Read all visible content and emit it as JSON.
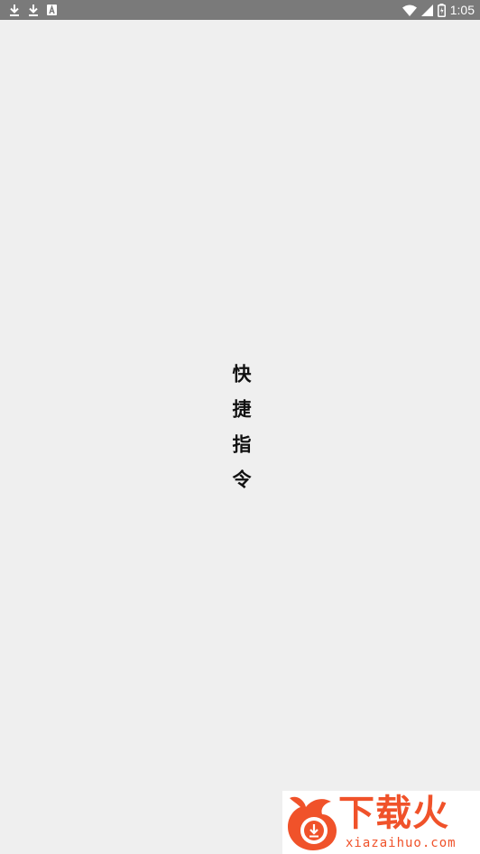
{
  "status_bar": {
    "time": "1:05",
    "left_icons": [
      "download-icon",
      "download-icon",
      "text-a-icon"
    ],
    "right_icons": [
      "wifi-icon",
      "signal-icon",
      "battery-icon"
    ],
    "background": "#7a7a7a"
  },
  "splash": {
    "title": "快捷指令",
    "background": "#efefef"
  },
  "watermark": {
    "name": "下载火",
    "domain": "xiazaihuo.com",
    "color": "#f0522a"
  }
}
